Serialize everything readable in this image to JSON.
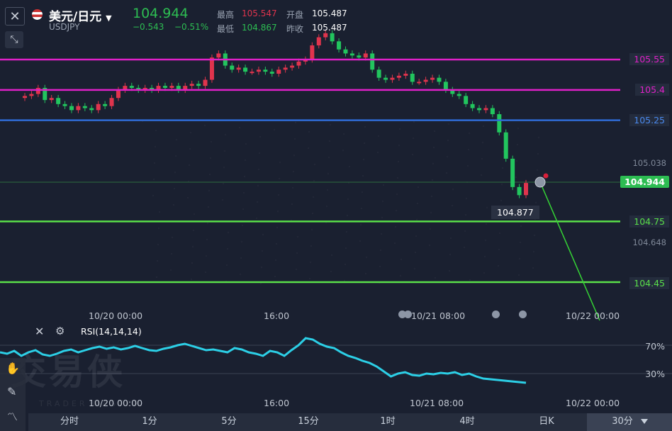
{
  "header": {
    "title": "美元/日元",
    "symbol": "USDJPY",
    "price": "104.944",
    "change": "−0.543",
    "change_pct": "−0.51%",
    "high_label": "最高",
    "high_value": "105.547",
    "low_label": "最低",
    "low_value": "104.867",
    "open_label": "开盘",
    "open_value": "105.487",
    "prev_label": "昨收",
    "prev_value": "105.487"
  },
  "levels": [
    {
      "price": "105.55",
      "color": "#e020c8"
    },
    {
      "price": "105.4",
      "color": "#e020c8"
    },
    {
      "price": "105.25",
      "color": "#2f6bd6"
    },
    {
      "price": "104.75",
      "color": "#5ae04a"
    },
    {
      "price": "104.45",
      "color": "#5ae04a"
    }
  ],
  "axis": {
    "ticks": [
      "105.038",
      "104.648"
    ],
    "current_price": "104.944",
    "current_color": "#2dbd52",
    "low_marker": "104.877"
  },
  "main_time_labels": [
    "10/20 00:00",
    "16:00",
    "10/21 08:00",
    "10/22 00:00"
  ],
  "rsi": {
    "label": "RSI(14,14,14)",
    "level_70": "70%",
    "level_30": "30%",
    "time_labels": [
      "10/20 00:00",
      "16:00",
      "10/21 08:00",
      "10/22 00:00"
    ]
  },
  "timeframes": [
    "分时",
    "1分",
    "5分",
    "15分",
    "1时",
    "4时",
    "日K",
    "30分"
  ],
  "watermark": {
    "text": "交易侠",
    "sub": "TRADER MASTER"
  },
  "colors": {
    "up": "#e0344d",
    "down": "#22c55e",
    "bg": "#1a2030"
  }
}
